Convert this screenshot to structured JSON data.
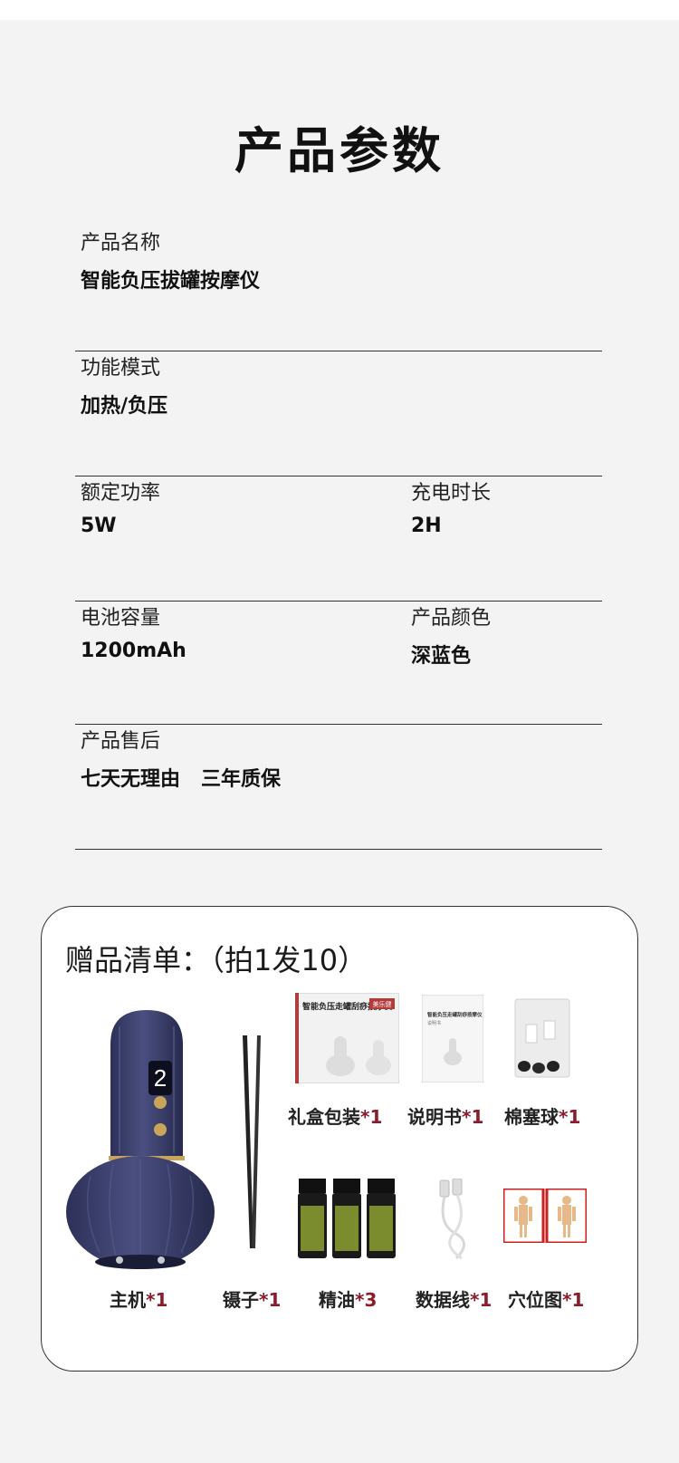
{
  "header": {
    "title": "产品参数"
  },
  "params": {
    "name": {
      "label": "产品名称",
      "value": "智能负压拔罐按摩仪"
    },
    "mode": {
      "label": "功能模式",
      "value": "加热/负压"
    },
    "power": {
      "label": "额定功率",
      "value": "5W"
    },
    "charge": {
      "label": "充电时长",
      "value": "2H"
    },
    "battery": {
      "label": "电池容量",
      "value": "1200mAh"
    },
    "color": {
      "label": "产品颜色",
      "value": "深蓝色"
    },
    "service": {
      "label": "产品售后",
      "value": "七天无理由   三年质保"
    }
  },
  "gifts": {
    "title": "赠品清单：（拍1发10）",
    "items": [
      {
        "name": "礼盒包装",
        "qty": "*1"
      },
      {
        "name": "说明书",
        "qty": "*1"
      },
      {
        "name": "棉塞球",
        "qty": "*1"
      },
      {
        "name": "主机",
        "qty": "*1"
      },
      {
        "name": "镊子",
        "qty": "*1"
      },
      {
        "name": "精油",
        "qty": "*3"
      },
      {
        "name": "数据线",
        "qty": "*1"
      },
      {
        "name": "穴位图",
        "qty": "*1"
      }
    ],
    "device_display": "2",
    "box_text": {
      "title": "智能负压走罐刮痧按摩仪",
      "brand": "美乐健"
    },
    "manual_text": {
      "title": "智能负压走罐刮痧按摩仪",
      "sub": "说明书"
    }
  },
  "colors": {
    "device": "#3b3f6b",
    "accent_qty": "#8a1c2b",
    "oil_label": "#7a8c2e"
  }
}
